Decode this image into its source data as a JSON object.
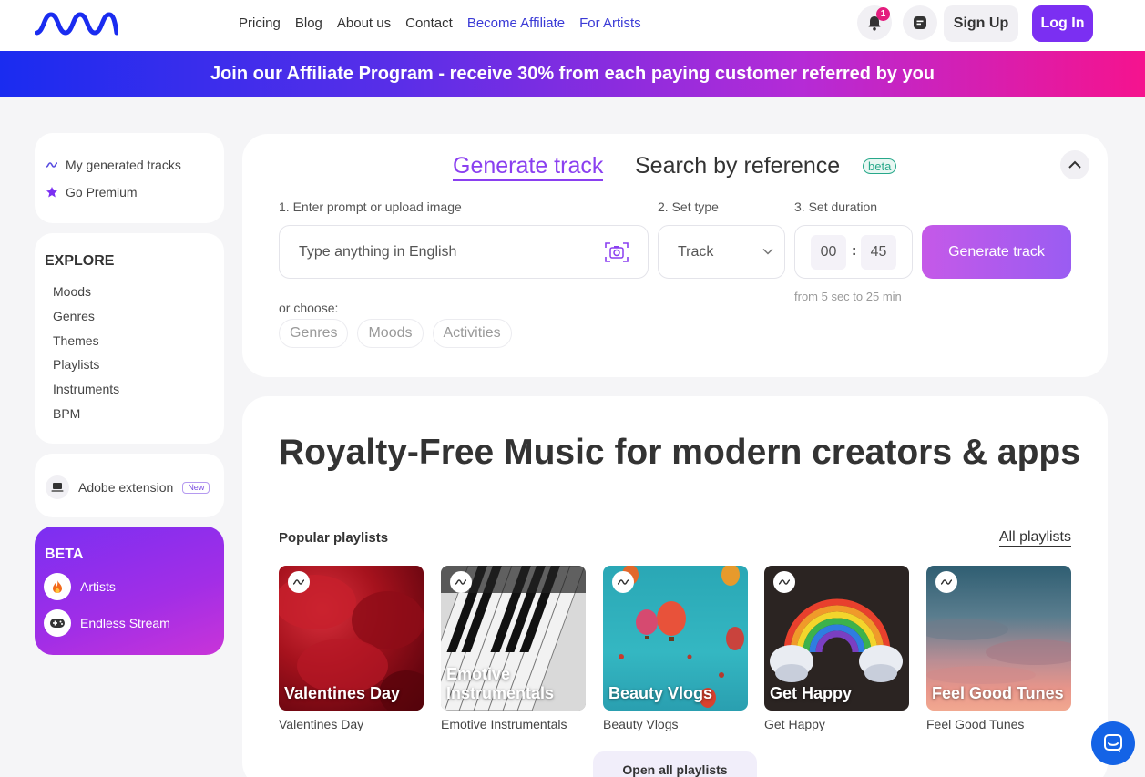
{
  "header": {
    "nav": [
      "Pricing",
      "Blog",
      "About us",
      "Contact",
      "Become Affiliate",
      "For Artists"
    ],
    "notification_count": "1",
    "signup_label": "Sign Up",
    "login_label": "Log In",
    "accent_color": "#7b2ff2"
  },
  "banner": {
    "text": "Join our Affiliate Program - receive 30% from each paying customer referred by you"
  },
  "sidebar": {
    "top_items": [
      {
        "label": "My generated tracks",
        "icon": "wave-icon"
      },
      {
        "label": "Go Premium",
        "icon": "star-icon"
      }
    ],
    "explore_heading": "EXPLORE",
    "explore_items": [
      "Moods",
      "Genres",
      "Themes",
      "Playlists",
      "Instruments",
      "BPM"
    ],
    "extension": {
      "label": "Adobe extension",
      "tag": "New"
    },
    "beta": {
      "heading": "BETA",
      "items": [
        {
          "label": "Artists",
          "icon": "fire-icon"
        },
        {
          "label": "Endless Stream",
          "icon": "gamepad-icon"
        }
      ]
    }
  },
  "generator": {
    "tab_generate": "Generate track",
    "tab_search": "Search by reference",
    "beta_tag": "beta",
    "step1_label": "1. Enter prompt or upload image",
    "prompt_placeholder": "Type anything in English",
    "step2_label": "2. Set type",
    "type_value": "Track",
    "step3_label": "3. Set duration",
    "duration_minutes": "00",
    "duration_seconds": "45",
    "duration_hint": "from 5 sec to 25 min",
    "generate_button": "Generate track",
    "or_choose": "or choose:",
    "chips": [
      "Genres",
      "Moods",
      "Activities"
    ]
  },
  "main": {
    "heading": "Royalty-Free Music for modern creators & apps",
    "popular_label": "Popular playlists",
    "all_playlists": "All playlists",
    "playlists": [
      {
        "title": "Valentines Day",
        "caption": "Valentines Day"
      },
      {
        "title": "Emotive Instrumentals",
        "caption": "Emotive Instrumentals"
      },
      {
        "title": "Beauty Vlogs",
        "caption": "Beauty Vlogs"
      },
      {
        "title": "Get Happy",
        "caption": "Get Happy"
      },
      {
        "title": "Feel Good Tunes",
        "caption": "Feel Good Tunes"
      }
    ],
    "open_all": "Open all playlists"
  }
}
